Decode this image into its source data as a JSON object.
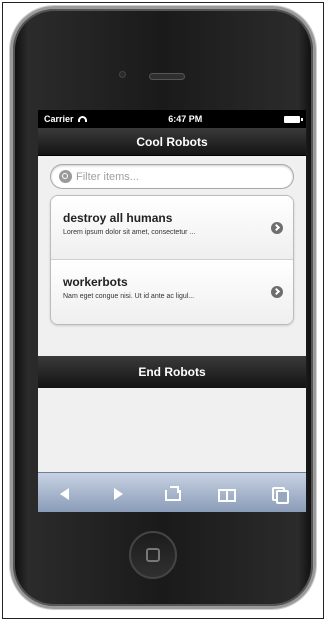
{
  "status_bar": {
    "carrier": "Carrier",
    "time": "6:47 PM"
  },
  "header": {
    "title": "Cool Robots"
  },
  "search": {
    "placeholder": "Filter items..."
  },
  "list": {
    "items": [
      {
        "title": "destroy all humans",
        "description": "Lorem ipsum dolor sit amet, consectetur ..."
      },
      {
        "title": "workerbots",
        "description": "Nam eget congue nisi. Ut id ante ac ligul..."
      }
    ]
  },
  "footer": {
    "title": "End Robots"
  },
  "toolbar": {
    "icons": [
      "back-arrow-icon",
      "forward-arrow-icon",
      "share-icon",
      "bookmarks-icon",
      "tabs-icon"
    ]
  },
  "colors": {
    "header_bg": "#141414",
    "toolbar_bg": "#a9b7cc",
    "list_bg": "#f0f0f0"
  }
}
